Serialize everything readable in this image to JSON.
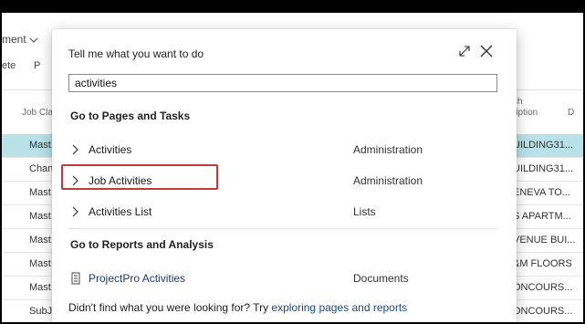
{
  "background": {
    "top_menu_label": "ment",
    "action_items": [
      "ete",
      "P"
    ],
    "column_left_header": "Job Cla",
    "column_right_header_line1": "ch",
    "column_right_header_line2": "ription",
    "column_right_header_extra": "D",
    "rows": [
      {
        "left": "Mast",
        "right": "UILDING31...",
        "selected": true
      },
      {
        "left": "Chan",
        "right": "UILDING31...",
        "selected": false
      },
      {
        "left": "Mast",
        "right": "ENEVA TO...",
        "selected": false
      },
      {
        "left": "Mast",
        "right": "S APARTM...",
        "selected": false
      },
      {
        "left": "Mast",
        "right": "VENUE BUI...",
        "selected": false
      },
      {
        "left": "Mast",
        "right": "&M FLOORS",
        "selected": false
      },
      {
        "left": "Mast",
        "right": "ONCOURS...",
        "selected": false
      },
      {
        "left": "SubJ",
        "right": "ONCOURS...",
        "selected": false
      }
    ]
  },
  "dialog": {
    "title": "Tell me what you want to do",
    "search_value": "activities",
    "section_pages": "Go to Pages and Tasks",
    "section_reports": "Go to Reports and Analysis",
    "results_pages": [
      {
        "label": "Activities",
        "category": "Administration",
        "icon": "chevron-right-icon"
      },
      {
        "label": "Job Activities",
        "category": "Administration",
        "icon": "chevron-right-icon"
      },
      {
        "label": "Activities List",
        "category": "Lists",
        "icon": "chevron-right-icon"
      }
    ],
    "results_reports": [
      {
        "label": "ProjectPro Activities",
        "category": "Documents",
        "icon": "report-document-icon"
      }
    ],
    "footer_text": "Didn't find what you were looking for? Try ",
    "footer_link": "exploring pages and reports",
    "expand_icon": "expand-icon",
    "close_icon": "close-icon"
  },
  "colors": {
    "selected_row": "#b8e1e8",
    "highlight_border": "#c23b3b",
    "link": "#1a4a8a"
  }
}
